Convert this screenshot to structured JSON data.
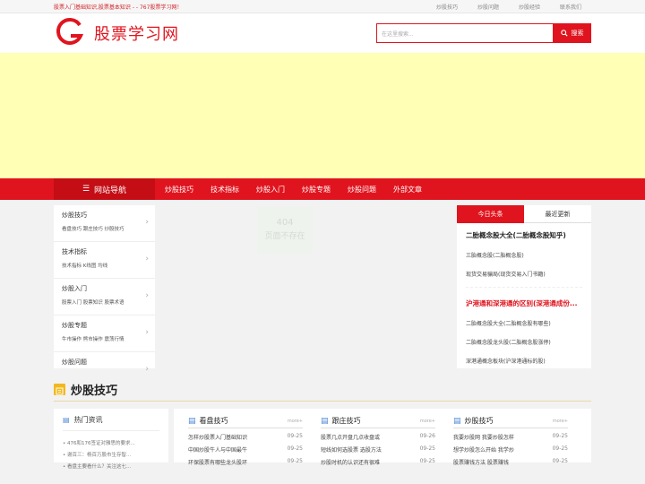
{
  "topbar": {
    "welcome": "股票入门基础知识,股票基本知识 - - 767股票学习网！",
    "links": [
      "炒股技巧",
      "炒股问题",
      "炒股经验",
      "联系我们"
    ]
  },
  "header": {
    "logo_letter": "G",
    "site_name": "股票学习网",
    "search_placeholder": "在这里搜索...",
    "search_button": "搜索"
  },
  "nav": {
    "home": "网站导航",
    "items": [
      "炒股技巧",
      "技术指标",
      "炒股入门",
      "炒股专题",
      "炒股问题",
      "外部文章"
    ]
  },
  "sidebar": {
    "items": [
      {
        "title": "炒股技巧",
        "sub": "看盘技巧 跟庄技巧 炒股技巧"
      },
      {
        "title": "技术指标",
        "sub": "技术指标 K线图 均线"
      },
      {
        "title": "炒股入门",
        "sub": "股票入门 股票知识 股票术语"
      },
      {
        "title": "炒股专题",
        "sub": "牛市操作 熊市操作 震荡行情"
      },
      {
        "title": "炒股问题",
        "sub": ""
      }
    ]
  },
  "center": {
    "error_code": "404",
    "error_text": "页面不存在"
  },
  "news": {
    "tab_active": "今日头条",
    "tab_inactive": "最近更新",
    "head1": "二胎概念股大全(二胎概念股知乎)",
    "links1": [
      "三胎概念股(二胎概念股)",
      "现货交易骗局(现货交易入门书籍)"
    ],
    "head2": "沪港通和深港通的区别(深港通成份...",
    "links2": [
      "二胎概念股大全(二胎概念股有哪些)",
      "二胎概念股龙头股(二胎概念股涨停)",
      "深港通概念板块(沪深港通标的股)"
    ]
  },
  "section": {
    "title": "炒股技巧"
  },
  "hot": {
    "title": "热门资讯",
    "items": [
      "476和176签证对雅思的要求...",
      "谢百三：杨百万股市生存智...",
      "看盘主要看什么？关注这七..."
    ]
  },
  "columns": [
    {
      "title": "看盘技巧",
      "more": "more+",
      "rows": [
        {
          "text": "怎样炒股票入门基础知识",
          "date": "09-25"
        },
        {
          "text": "中国炒股牛人与中国最牛",
          "date": "09-25"
        },
        {
          "text": "环保股票有哪些龙头股环",
          "date": "09-25"
        }
      ]
    },
    {
      "title": "跟庄技巧",
      "more": "more+",
      "rows": [
        {
          "text": "股票几点开盘几点收盘或",
          "date": "09-26"
        },
        {
          "text": "短线如何选股票 选股方法",
          "date": "09-25"
        },
        {
          "text": "炒股时机的认识还有很难",
          "date": "09-25"
        }
      ]
    },
    {
      "title": "炒股技巧",
      "more": "more+",
      "rows": [
        {
          "text": "我要炒股网 我要炒股怎样",
          "date": "09-25"
        },
        {
          "text": "想学炒股怎么开始 我学炒",
          "date": "09-25"
        },
        {
          "text": "股票赚钱方法 股票赚钱",
          "date": "09-25"
        }
      ]
    }
  ],
  "colors": {
    "brand_red": "#e0141e",
    "banner_yellow": "#ffffb5",
    "section_gold": "#f2b81e"
  }
}
